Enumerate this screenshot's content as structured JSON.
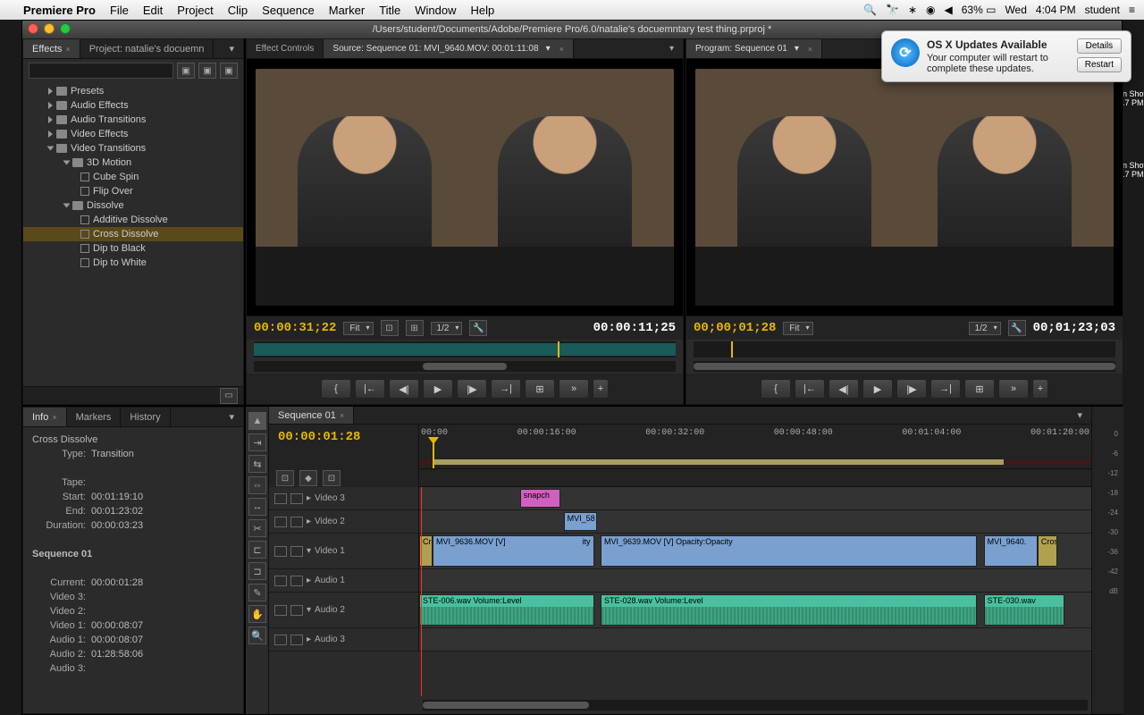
{
  "menubar": {
    "app": "Premiere Pro",
    "items": [
      "File",
      "Edit",
      "Project",
      "Clip",
      "Sequence",
      "Marker",
      "Title",
      "Window",
      "Help"
    ],
    "right": {
      "battery": "63%",
      "day": "Wed",
      "time": "4:04 PM",
      "user": "student"
    }
  },
  "window": {
    "title": "/Users/student/Documents/Adobe/Premiere Pro/6.0/natalie's docuemntary test thing.prproj *"
  },
  "effects": {
    "tab1": "Effects",
    "tab2": "Project: natalie's docuemn",
    "search_ph": "",
    "tree": [
      {
        "lvl": 1,
        "open": false,
        "type": "folder",
        "label": "Presets"
      },
      {
        "lvl": 1,
        "open": false,
        "type": "folder",
        "label": "Audio Effects"
      },
      {
        "lvl": 1,
        "open": false,
        "type": "folder",
        "label": "Audio Transitions"
      },
      {
        "lvl": 1,
        "open": false,
        "type": "folder",
        "label": "Video Effects"
      },
      {
        "lvl": 1,
        "open": true,
        "type": "folder",
        "label": "Video Transitions"
      },
      {
        "lvl": 2,
        "open": true,
        "type": "folder",
        "label": "3D Motion"
      },
      {
        "lvl": 3,
        "type": "fx",
        "label": "Cube Spin"
      },
      {
        "lvl": 3,
        "type": "fx",
        "label": "Flip Over"
      },
      {
        "lvl": 2,
        "open": true,
        "type": "folder",
        "label": "Dissolve"
      },
      {
        "lvl": 3,
        "type": "fx",
        "label": "Additive Dissolve"
      },
      {
        "lvl": 3,
        "type": "fx",
        "label": "Cross Dissolve",
        "sel": true
      },
      {
        "lvl": 3,
        "type": "fx",
        "label": "Dip to Black"
      },
      {
        "lvl": 3,
        "type": "fx",
        "label": "Dip to White"
      }
    ]
  },
  "source": {
    "tab1": "Effect Controls",
    "tab2": "Source: Sequence 01: MVI_9640.MOV: 00:01:11:08",
    "tc_in": "00:00:31;22",
    "fit": "Fit",
    "zoom": "1/2",
    "tc_out": "00:00:11;25"
  },
  "program": {
    "tab": "Program: Sequence 01",
    "tc_in": "00;00;01;28",
    "fit": "Fit",
    "zoom": "1/2",
    "tc_out": "00;01;23;03"
  },
  "info": {
    "tabs": [
      "Info",
      "Markers",
      "History"
    ],
    "name": "Cross Dissolve",
    "type_lbl": "Type:",
    "type": "Transition",
    "tape_lbl": "Tape:",
    "start_lbl": "Start:",
    "start": "00:01:19:10",
    "end_lbl": "End:",
    "end": "00:01:23:02",
    "dur_lbl": "Duration:",
    "dur": "00:00:03:23",
    "seq": "Sequence 01",
    "current_lbl": "Current:",
    "current": "00:00:01:28",
    "v3": "Video 3:",
    "v2": "Video 2:",
    "v1": "Video 1:",
    "v1v": "00:00:08:07",
    "a1": "Audio 1:",
    "a1v": "00:00:08:07",
    "a2": "Audio 2:",
    "a2v": "01:28:58:06",
    "a3": "Audio 3:"
  },
  "timeline": {
    "tab": "Sequence 01",
    "tc": "00:00:01:28",
    "ruler": [
      "00:00",
      "00:00:16:00",
      "00:00:32:00",
      "00:00:48:00",
      "00:01:04:00",
      "00:01:20:00"
    ],
    "tracks": {
      "v3": "Video 3",
      "v2": "Video 2",
      "v1": "Video 1",
      "a1": "Audio 1",
      "a2": "Audio 2",
      "a3": "Audio 3"
    },
    "clips": {
      "snap": "snapch",
      "mvi58": "MVI_58",
      "v1a": "MVI_9636.MOV [V]",
      "v1a_fx": "ity",
      "v1b": "MVI_9639.MOV [V]",
      "v1b_fx": "Opacity:Opacity",
      "v1c": "MVI_9640.",
      "cross": "Cross",
      "a2a": "STE-006.wav",
      "a2a_fx": "Volume:Level",
      "a2b": "STE-028.wav",
      "a2b_fx": "Volume:Level",
      "a2c": "STE-030.wav"
    },
    "meters": [
      "0",
      "-6",
      "-12",
      "-18",
      "-24",
      "-30",
      "-36",
      "-42",
      "",
      "dB"
    ]
  },
  "notif": {
    "title": "OS X Updates Available",
    "body": "Your computer will restart to complete these updates.",
    "b1": "Details",
    "b2": "Restart"
  },
  "desktop": {
    "l1": "n Shot",
    "l2": ".7 PM",
    "l3": "n Shot",
    "l4": ".7 PM"
  },
  "transport_icons": [
    "{",
    "|←",
    "◀|",
    "▶",
    "|▶",
    "→|",
    "⊞",
    "»"
  ]
}
